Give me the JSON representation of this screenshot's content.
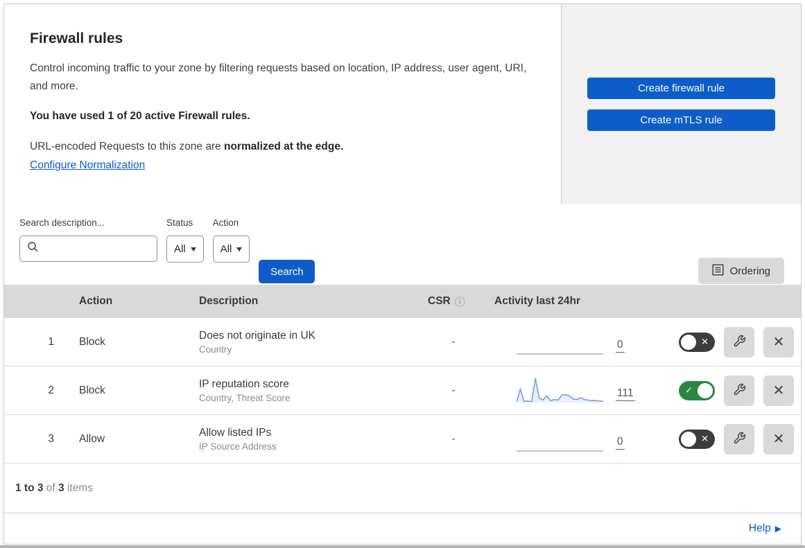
{
  "colors": {
    "primary_blue": "#0d5cc9",
    "panel_gray": "#f1f1f1",
    "header_gray": "#d9d9d9",
    "toggle_on_green": "#2d8543",
    "toggle_off_charcoal": "#3d3d3d",
    "sparkline_blue": "#6f96e3",
    "link_underline_blue": "#2f64c9"
  },
  "intro": {
    "title": "Firewall rules",
    "description": "Control incoming traffic to your zone by filtering requests based on location, IP address, user agent, URI, and more.",
    "usage": "You have used 1 of 20 active Firewall rules.",
    "normalization_prefix": "URL-encoded Requests to this zone are ",
    "normalization_bold": "normalized at the edge.",
    "normalization_link": "Configure Normalization"
  },
  "cta": {
    "create_firewall_rule": "Create firewall rule",
    "create_mtls_rule": "Create mTLS rule"
  },
  "filters": {
    "search_label": "Search description...",
    "status_label": "Status",
    "status_value": "All",
    "action_label": "Action",
    "action_value": "All",
    "search_button": "Search",
    "ordering_button": "Ordering"
  },
  "table": {
    "headers": {
      "action": "Action",
      "description": "Description",
      "csr": "CSR",
      "info_icon": "ⓘ",
      "activity": "Activity last 24hr"
    },
    "rows": [
      {
        "index": "1",
        "action": "Block",
        "description": "Does not originate in UK",
        "criteria": "Country",
        "csr": "-",
        "activity_count": "0",
        "enabled": false
      },
      {
        "index": "2",
        "action": "Block",
        "description": "IP reputation score",
        "criteria": "Country, Threat Score",
        "csr": "-",
        "activity_count": "111",
        "enabled": true
      },
      {
        "index": "3",
        "action": "Allow",
        "description": "Allow listed IPs",
        "criteria": "IP Source Address",
        "csr": "-",
        "activity_count": "0",
        "enabled": false
      }
    ]
  },
  "footer": {
    "count_range": "1 to 3",
    "count_of": " of ",
    "count_total": "3",
    "count_items": " items",
    "help": "Help",
    "help_arrow": "▶"
  },
  "toggle_glyphs": {
    "on_check": "✓",
    "off_x": "✕"
  },
  "chart_data": [
    {
      "type": "area",
      "row": 1,
      "title": "Activity last 24hr (rule 1)",
      "total": 0,
      "values": [
        0,
        0,
        0,
        0,
        0,
        0,
        0,
        0,
        0,
        0,
        0,
        0,
        0,
        0,
        0,
        0,
        0,
        0,
        0,
        0,
        0,
        0,
        0,
        0
      ],
      "ylim": [
        0,
        100
      ]
    },
    {
      "type": "area",
      "row": 2,
      "title": "Activity last 24hr (rule 2)",
      "total": 111,
      "values": [
        3,
        55,
        5,
        6,
        4,
        100,
        18,
        10,
        28,
        8,
        12,
        10,
        30,
        32,
        28,
        15,
        12,
        20,
        12,
        10,
        8,
        8,
        6,
        5
      ],
      "ylim": [
        0,
        100
      ]
    },
    {
      "type": "area",
      "row": 3,
      "title": "Activity last 24hr (rule 3)",
      "total": 0,
      "values": [
        0,
        0,
        0,
        0,
        0,
        0,
        0,
        0,
        0,
        0,
        0,
        0,
        0,
        0,
        0,
        0,
        0,
        0,
        0,
        0,
        0,
        0,
        0,
        0
      ],
      "ylim": [
        0,
        100
      ]
    }
  ]
}
